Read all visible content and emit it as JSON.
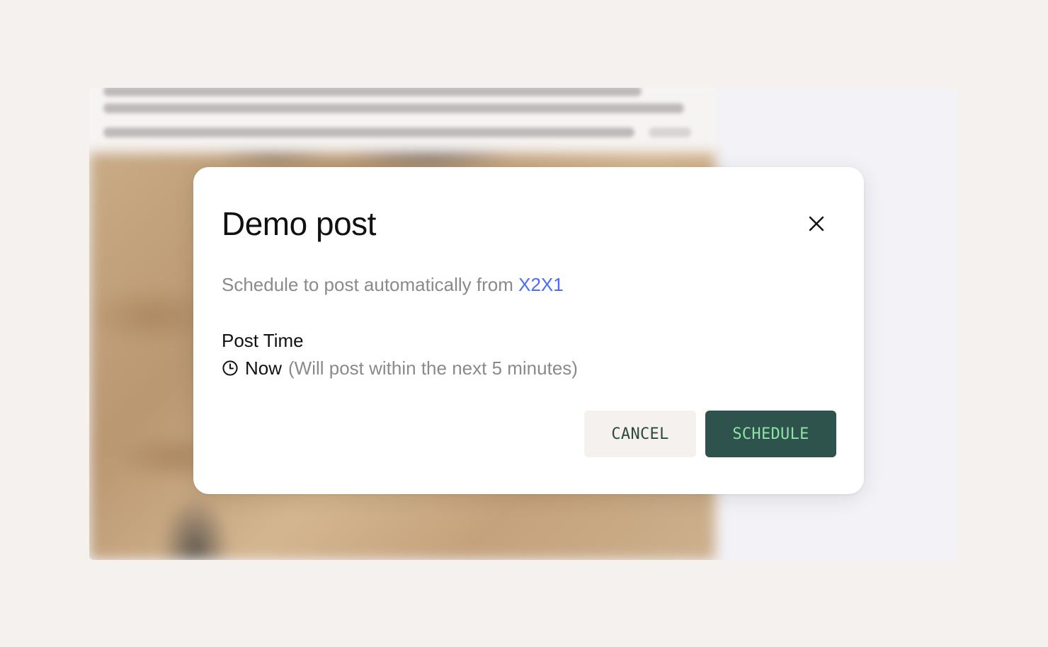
{
  "modal": {
    "title": "Demo post",
    "subtitle_prefix": "Schedule to post automatically from",
    "account_name": "X2X1",
    "post_time": {
      "label": "Post Time",
      "value": "Now",
      "hint": "(Will post within the next 5 minutes)"
    },
    "buttons": {
      "cancel_label": "CANCEL",
      "schedule_label": "SCHEDULE"
    },
    "icons": {
      "close": "close-icon",
      "clock": "clock-icon"
    }
  },
  "colors": {
    "page_background": "#f4f1ef",
    "modal_background": "#ffffff",
    "title_text": "#111111",
    "muted_text": "#8a8a8a",
    "link": "#4a6cf7",
    "schedule_button_bg": "#2d534c",
    "schedule_button_text": "#8fe2a6",
    "cancel_button_bg": "#f4f1ef",
    "cancel_button_text": "#2d4a40"
  }
}
